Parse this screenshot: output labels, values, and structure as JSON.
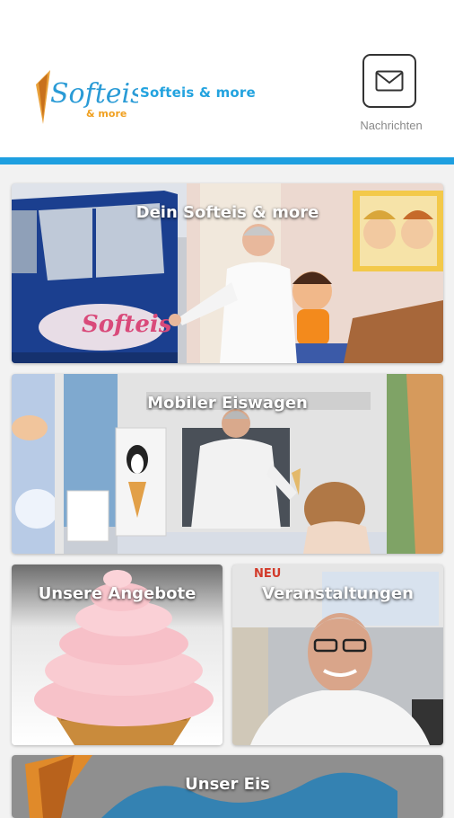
{
  "header": {
    "logo_script": "Softeis",
    "logo_subscript": "& more",
    "brand_text": "Softeis & more",
    "messages_label": "Nachrichten"
  },
  "tiles": [
    {
      "title": "Dein Softeis & more"
    },
    {
      "title": "Mobiler Eiswagen"
    },
    {
      "title": "Unsere Angebote"
    },
    {
      "title": "Veranstaltungen"
    },
    {
      "title": "Unser Eis"
    }
  ],
  "photo_text": {
    "van_logo": "Softeis",
    "sign_neu": "NEU"
  },
  "colors": {
    "accent": "#1e9fe0",
    "brand_text": "#23a3df"
  }
}
